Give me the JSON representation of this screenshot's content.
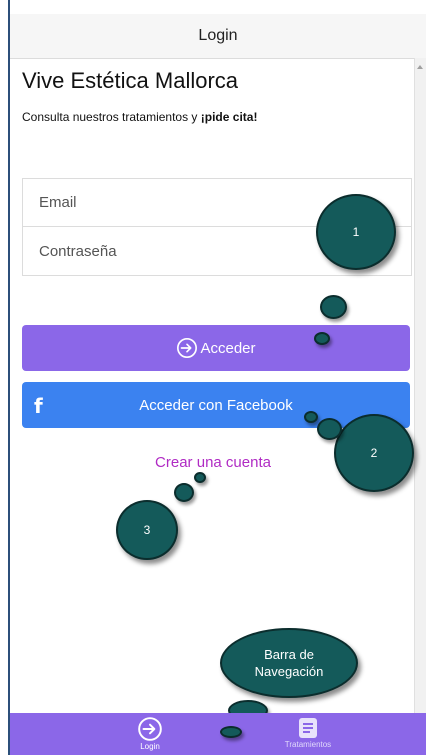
{
  "header": {
    "title": "Login"
  },
  "main": {
    "title": "Vive Estética Mallorca",
    "subtitle_prefix": "Consulta nuestros tratamientos y ",
    "subtitle_bold": "¡pide cita!",
    "email_placeholder": "Email",
    "password_placeholder": "Contraseña",
    "login_button": "Acceder",
    "facebook_button": "Acceder con Facebook",
    "create_account": "Crear una cuenta"
  },
  "annotations": {
    "bubble1": "1",
    "bubble2": "2",
    "bubble3": "3",
    "nav_bubble_line1": "Barra de",
    "nav_bubble_line2": "Navegación"
  },
  "tabbar": {
    "tabs": [
      {
        "label": "Login",
        "icon": "login-icon"
      },
      {
        "label": "Tratamientos",
        "icon": "document-icon"
      }
    ]
  },
  "colors": {
    "accent": "#8b67e8",
    "facebook": "#3b82f0",
    "link": "#b02bc4",
    "bubble": "#145a5a"
  }
}
